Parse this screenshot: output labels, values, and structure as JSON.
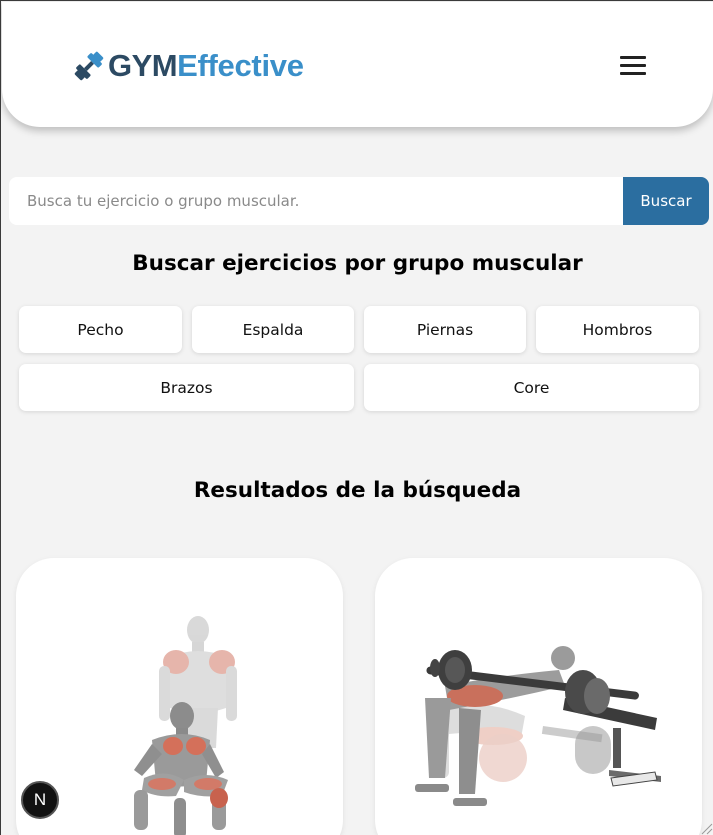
{
  "header": {
    "logo_gym": "GYM",
    "logo_effective": "Effective",
    "menu_icon": "hamburger-menu-icon",
    "logo_icon": "dumbbell-icon"
  },
  "search": {
    "placeholder": "Busca tu ejercicio o grupo muscular.",
    "value": "",
    "button_label": "Buscar"
  },
  "muscle_groups": {
    "title": "Buscar ejercicios por grupo muscular",
    "items": [
      {
        "label": "Pecho"
      },
      {
        "label": "Espalda"
      },
      {
        "label": "Piernas"
      },
      {
        "label": "Hombros"
      },
      {
        "label": "Brazos"
      },
      {
        "label": "Core"
      }
    ]
  },
  "results": {
    "title": "Resultados de la búsqueda",
    "cards": [
      {
        "image": "squat-exercise-illustration"
      },
      {
        "image": "barbell-hip-thrust-illustration"
      }
    ]
  },
  "dev_badge": {
    "label": "N"
  },
  "colors": {
    "background": "#f3f3f3",
    "brand_dark": "#2c4a63",
    "brand_light": "#3a8fc9",
    "search_button": "#2b6ea0",
    "muscle_highlight": "#d8705a"
  }
}
